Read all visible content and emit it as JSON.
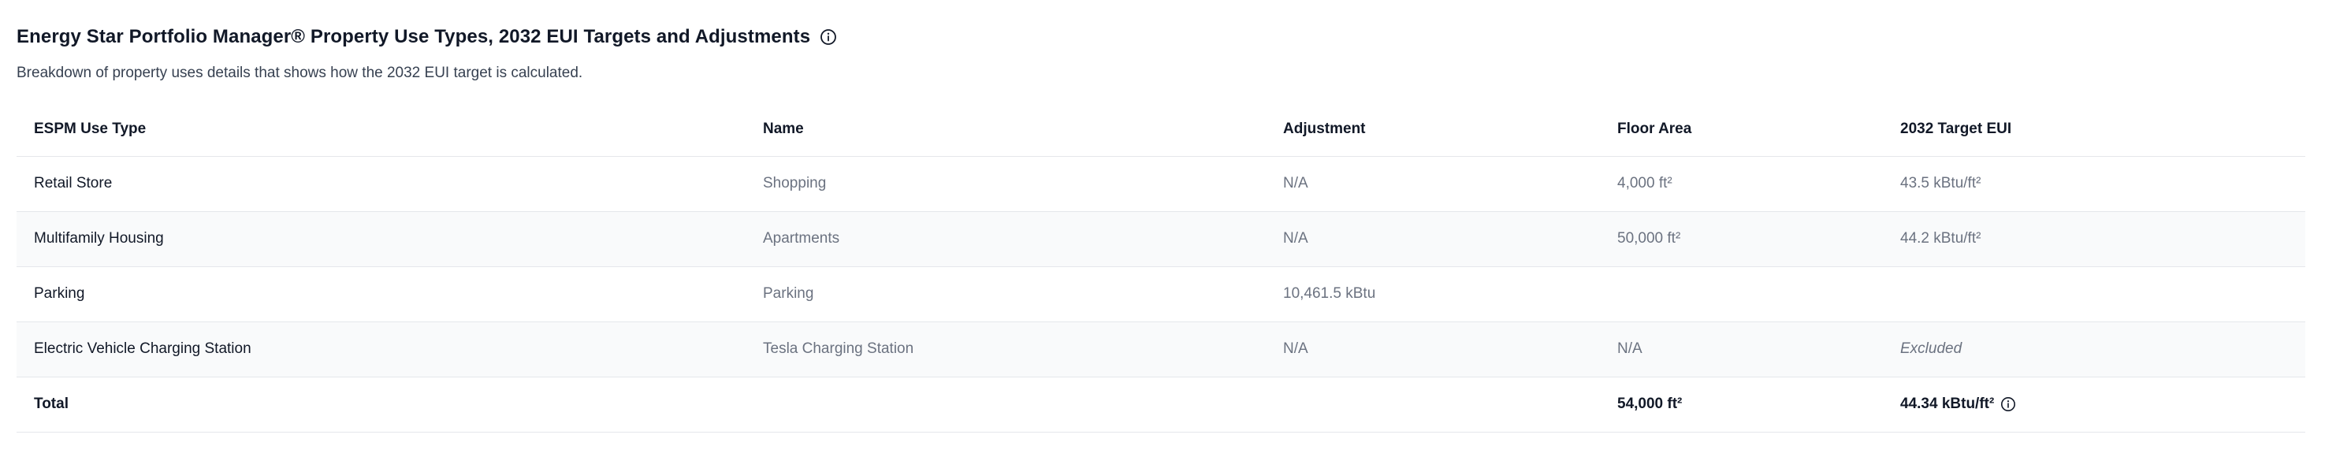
{
  "header": {
    "title": "Energy Star Portfolio Manager® Property Use Types, 2032 EUI Targets and Adjustments",
    "subtitle": "Breakdown of property uses details that shows how the 2032 EUI target is calculated.",
    "info_icon": "info-circle-icon"
  },
  "table": {
    "columns": [
      "ESPM Use Type",
      "Name",
      "Adjustment",
      "Floor Area",
      "2032 Target EUI"
    ],
    "rows": [
      {
        "use_type": "Retail Store",
        "name": "Shopping",
        "adjustment": "N/A",
        "floor_area": "4,000 ft²",
        "target_eui": "43.5 kBtu/ft²"
      },
      {
        "use_type": "Multifamily Housing",
        "name": "Apartments",
        "adjustment": "N/A",
        "floor_area": "50,000 ft²",
        "target_eui": "44.2 kBtu/ft²"
      },
      {
        "use_type": "Parking",
        "name": "Parking",
        "adjustment": "10,461.5 kBtu",
        "floor_area": "",
        "target_eui": ""
      },
      {
        "use_type": "Electric Vehicle Charging Station",
        "name": "Tesla Charging Station",
        "adjustment": "N/A",
        "floor_area": "N/A",
        "target_eui": "Excluded"
      }
    ],
    "total": {
      "label": "Total",
      "floor_area": "54,000 ft²",
      "target_eui": "44.34 kBtu/ft²"
    }
  },
  "colors": {
    "text_primary": "#111827",
    "text_secondary": "#6b7280",
    "row_alt_bg": "#f9fafb",
    "border": "#e5e7eb"
  }
}
